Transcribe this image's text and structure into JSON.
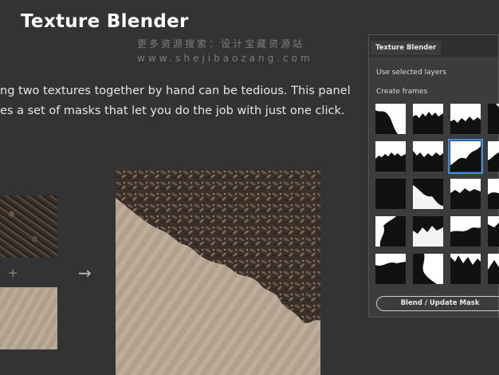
{
  "header": {
    "title": "Texture Blender",
    "watermark_cn": "更多资源搜索：设计宝藏资源站",
    "watermark_url": "www.shejibaozang.com"
  },
  "description": {
    "line1": "ng two textures together by hand can be tedious. This panel",
    "line2": "es a set of masks that let you do the job with just one click."
  },
  "demo": {
    "plus": "+",
    "arrow": "→"
  },
  "panel": {
    "tab_label": "Texture Blender",
    "use_selected_layers": "Use selected layers",
    "create_frames": "Create frames",
    "selected_mask_index": 6,
    "mask_count": 20,
    "blend_button": "Blend / Update Mask"
  },
  "colors": {
    "background": "#333333",
    "panel_bg": "#3c3c3c",
    "selection": "#3d8ee6"
  }
}
